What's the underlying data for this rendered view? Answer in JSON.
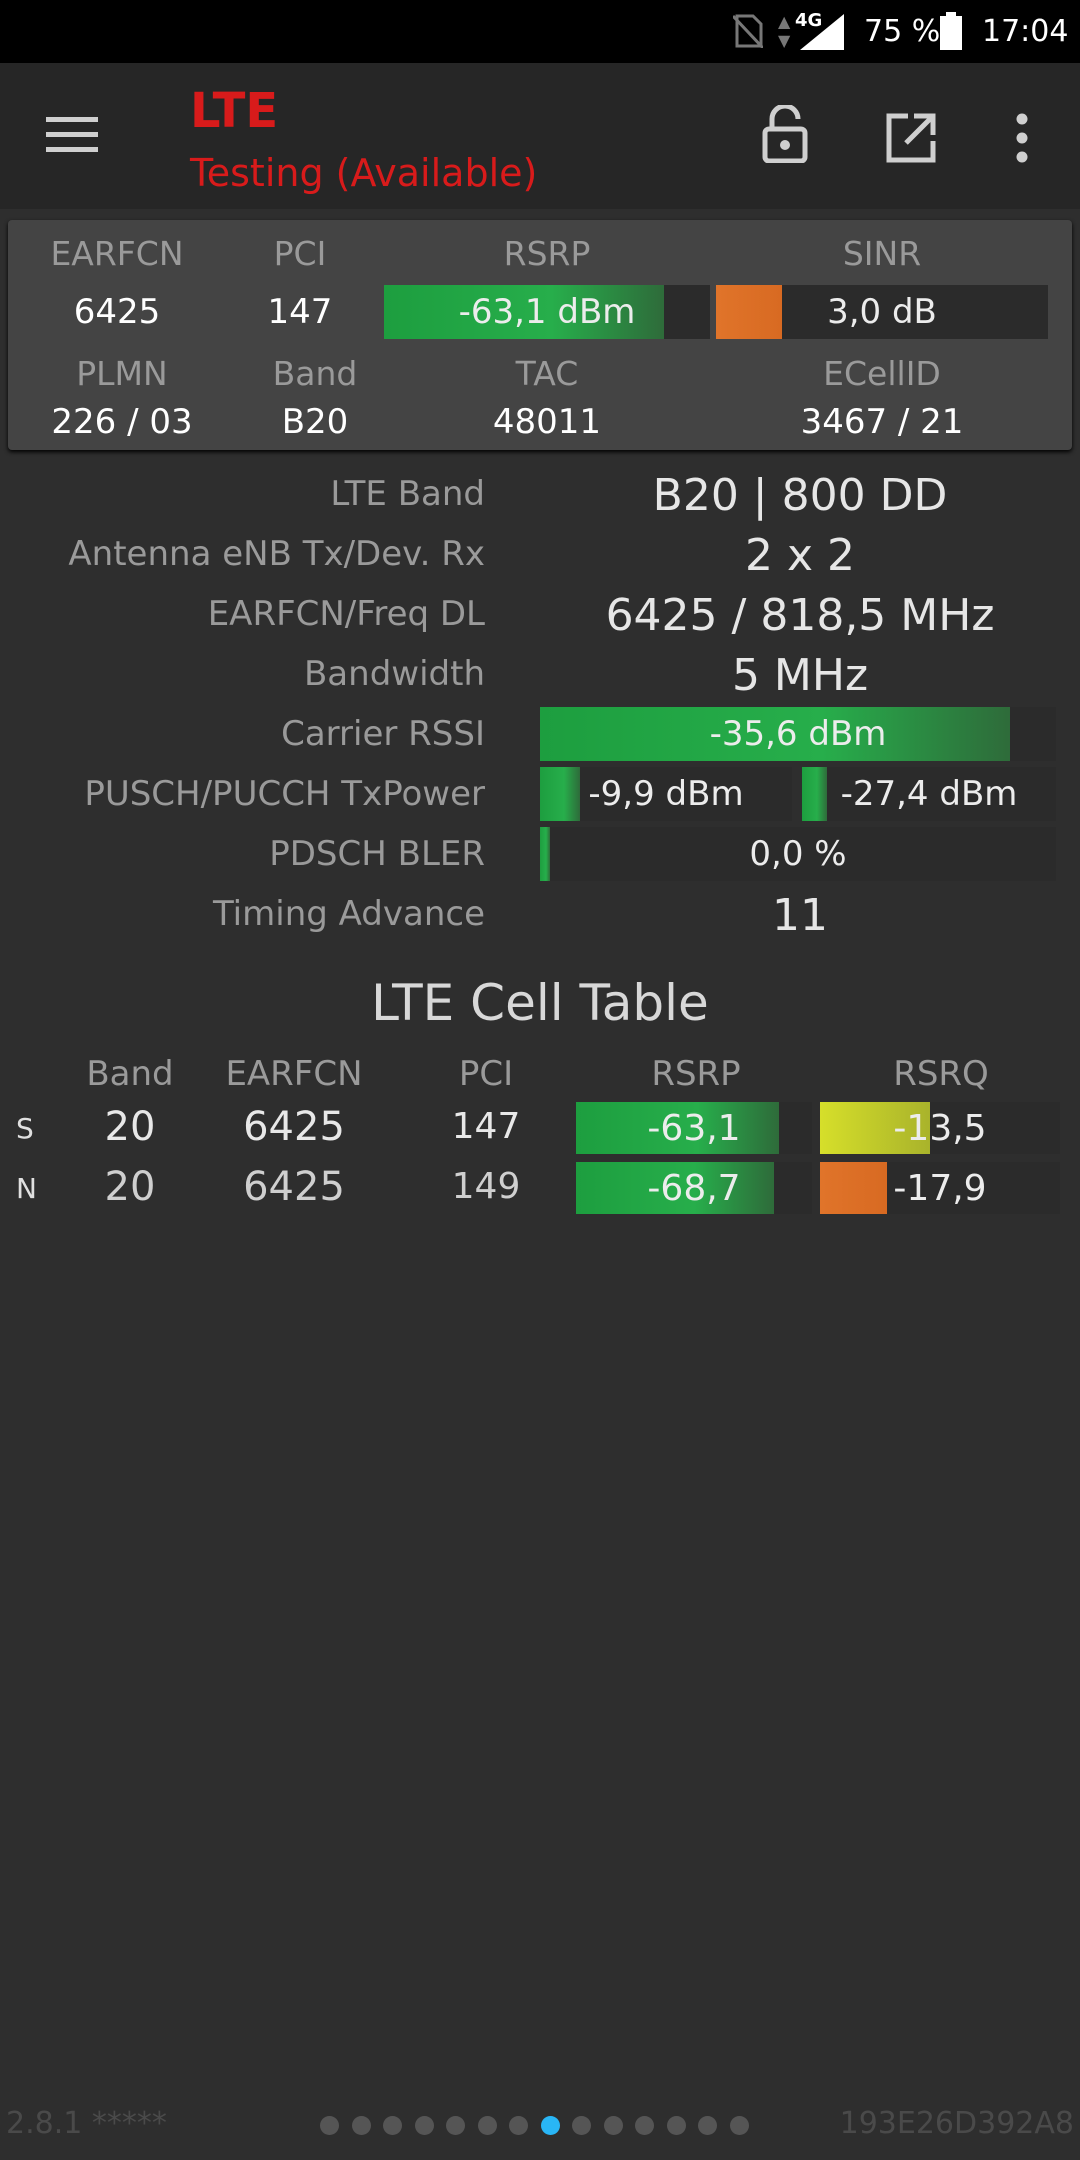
{
  "status_bar": {
    "network": "4G",
    "battery": "75 %",
    "time": "17:04"
  },
  "app_bar": {
    "title": "LTE",
    "subtitle": "Testing (Available)"
  },
  "summary": {
    "headers_row1": [
      "EARFCN",
      "PCI",
      "RSRP",
      "SINR"
    ],
    "earfcn": "6425",
    "pci": "147",
    "rsrp": "-63,1 dBm",
    "rsrp_fill": 0.86,
    "sinr": "3,0 dB",
    "sinr_fill": 0.2,
    "headers_row2": [
      "PLMN",
      "Band",
      "TAC",
      "ECellID"
    ],
    "plmn": "226 / 03",
    "band": "B20",
    "tac": "48011",
    "ecellid": "3467 / 21"
  },
  "details": {
    "lte_band_label": "LTE Band",
    "lte_band": "B20 | 800 DD",
    "antenna_label": "Antenna eNB Tx/Dev. Rx",
    "antenna": "2 x 2",
    "earfcn_freq_label": "EARFCN/Freq DL",
    "earfcn_freq": "6425 / 818,5 MHz",
    "bandwidth_label": "Bandwidth",
    "bandwidth": "5 MHz",
    "carrier_rssi_label": "Carrier RSSI",
    "carrier_rssi": "-35,6 dBm",
    "carrier_rssi_fill": 0.91,
    "txpower_label": "PUSCH/PUCCH TxPower",
    "pusch": "-9,9 dBm",
    "pusch_fill": 0.16,
    "pucch": "-27,4 dBm",
    "pucch_fill": 0.1,
    "bler_label": "PDSCH BLER",
    "bler": "0,0 %",
    "bler_fill": 0.02,
    "ta_label": "Timing Advance",
    "ta": "11"
  },
  "cell_table": {
    "title": "LTE Cell Table",
    "headers": [
      "Band",
      "EARFCN",
      "PCI",
      "RSRP",
      "RSRQ"
    ],
    "rows": [
      {
        "type": "S",
        "band": "20",
        "earfcn": "6425",
        "pci": "147",
        "rsrp": "-63,1",
        "rsrp_fill": 0.86,
        "rsrq": "-13,5",
        "rsrq_fill": 0.46
      },
      {
        "type": "N",
        "band": "20",
        "earfcn": "6425",
        "pci": "149",
        "rsrp": "-68,7",
        "rsrp_fill": 0.84,
        "rsrq": "-17,9",
        "rsrq_fill": 0.28
      }
    ]
  },
  "footer": {
    "version": "2.8.1 *****",
    "device_id": "193E26D392A8",
    "pages": 14,
    "active_page": 8
  },
  "colors": {
    "accent_red": "#d81b1b",
    "good_green": "#27ae4b",
    "warn_orange": "#e0742a",
    "mid_yellow": "#d6df2a",
    "active_dot": "#29b6f6"
  }
}
